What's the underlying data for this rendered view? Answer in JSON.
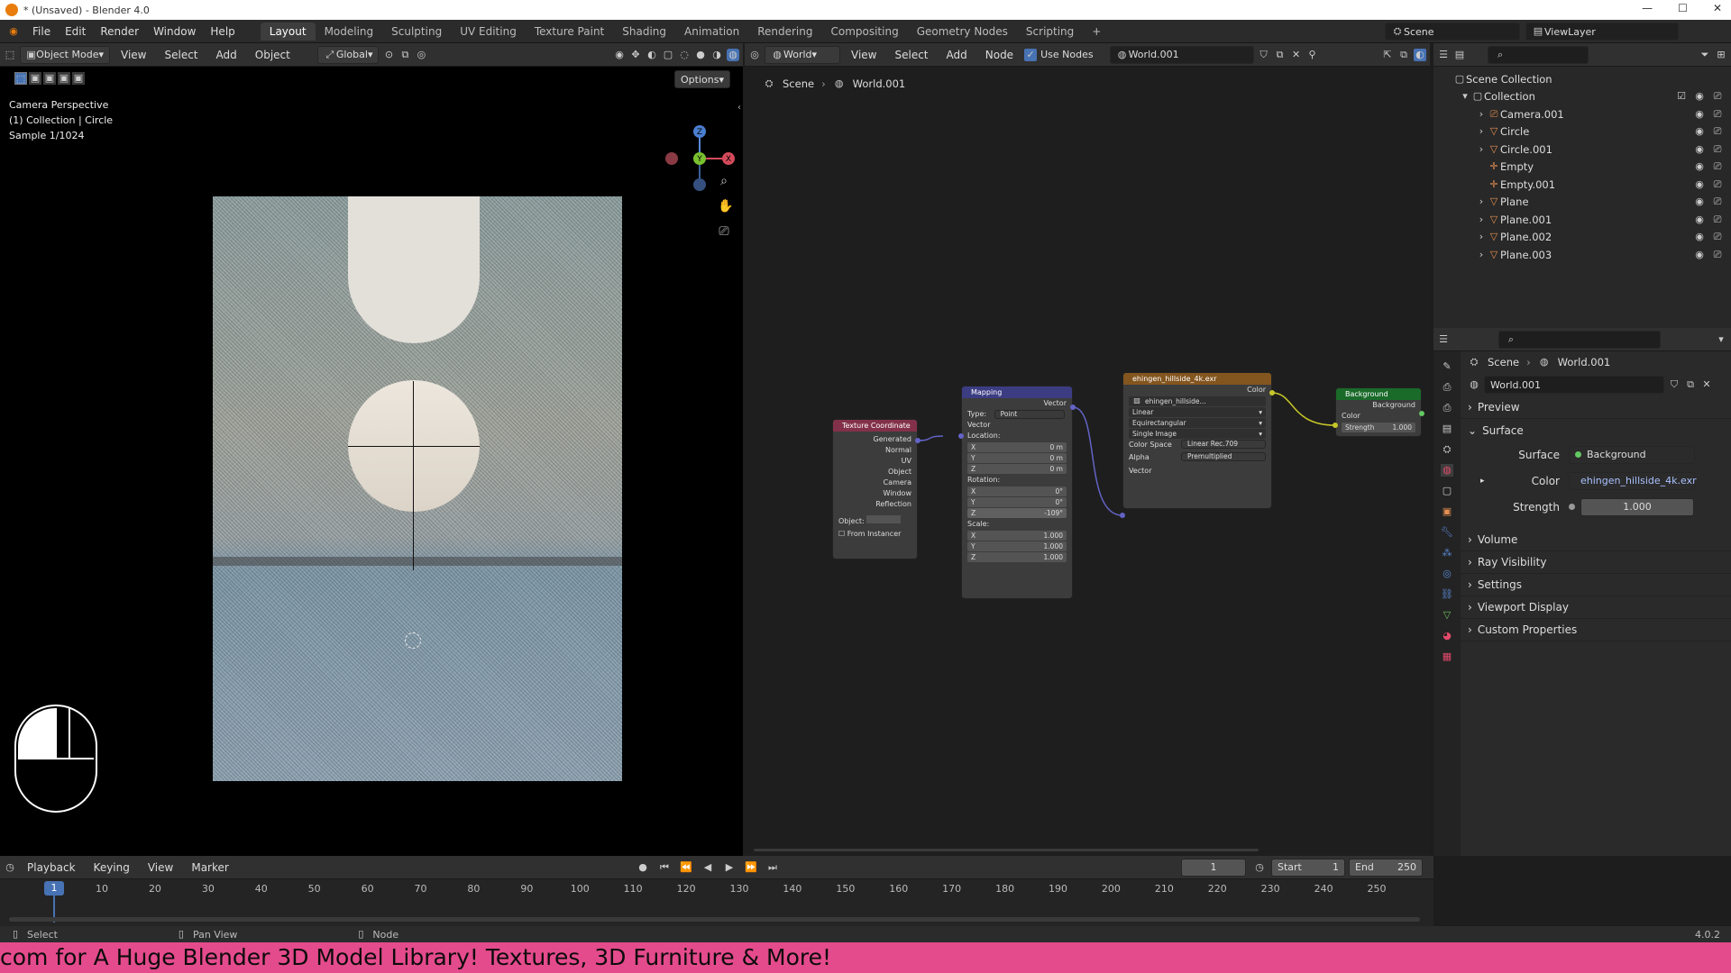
{
  "window": {
    "title": "* (Unsaved) - Blender 4.0",
    "controls": [
      "—",
      "☐",
      "✕"
    ]
  },
  "menu": [
    "File",
    "Edit",
    "Render",
    "Window",
    "Help"
  ],
  "workspaces": [
    "Layout",
    "Modeling",
    "Sculpting",
    "UV Editing",
    "Texture Paint",
    "Shading",
    "Animation",
    "Rendering",
    "Compositing",
    "Geometry Nodes",
    "Scripting",
    "+"
  ],
  "scene_selector": {
    "scene": "Scene",
    "view_layer": "ViewLayer"
  },
  "viewport": {
    "mode": "Object Mode",
    "menus": [
      "View",
      "Select",
      "Add",
      "Object"
    ],
    "transform": "Global",
    "options": "Options",
    "overlay_lines": [
      "Camera Perspective",
      "(1) Collection | Circle",
      "Sample 1/1024"
    ],
    "axes": {
      "z": "Z",
      "y": "Y",
      "x": "X"
    }
  },
  "node_editor": {
    "type": "World",
    "menus": [
      "View",
      "Select",
      "Add",
      "Node"
    ],
    "use_nodes_label": "Use Nodes",
    "world_name": "World.001",
    "breadcrumb": [
      "Scene",
      "World.001"
    ],
    "nodes": {
      "texcoord": {
        "title": "Texture Coordinate",
        "outputs": [
          "Generated",
          "Normal",
          "UV",
          "Object",
          "Camera",
          "Window",
          "Reflection"
        ],
        "object_label": "Object:",
        "from_instancer": "From Instancer"
      },
      "mapping": {
        "title": "Mapping",
        "out": "Vector",
        "type_label": "Type:",
        "type_value": "Point",
        "vector_in": "Vector",
        "location_label": "Location:",
        "location": [
          [
            "X",
            "0 m"
          ],
          [
            "Y",
            "0 m"
          ],
          [
            "Z",
            "0 m"
          ]
        ],
        "rotation_label": "Rotation:",
        "rotation": [
          [
            "X",
            "0°"
          ],
          [
            "Y",
            "0°"
          ],
          [
            "Z",
            "-109°"
          ]
        ],
        "scale_label": "Scale:",
        "scale": [
          [
            "X",
            "1.000"
          ],
          [
            "Y",
            "1.000"
          ],
          [
            "Z",
            "1.000"
          ]
        ]
      },
      "envtex": {
        "title": "ehingen_hillside_4k.exr",
        "out": "Color",
        "image": "ehingen_hillside...",
        "interp": "Linear",
        "projection": "Equirectangular",
        "source": "Single Image",
        "colorspace_label": "Color Space",
        "colorspace": "Linear Rec.709",
        "alpha_label": "Alpha",
        "alpha": "Premultiplied",
        "vector_in": "Vector"
      },
      "background": {
        "title": "Background",
        "out": "Background",
        "color_in": "Color",
        "strength_label": "Strength",
        "strength": "1.000"
      }
    }
  },
  "outliner": {
    "root": "Scene Collection",
    "collection": "Collection",
    "items": [
      "Camera.001",
      "Circle",
      "Circle.001",
      "Empty",
      "Empty.001",
      "Plane",
      "Plane.001",
      "Plane.002",
      "Plane.003"
    ]
  },
  "properties": {
    "breadcrumb": [
      "Scene",
      "World.001"
    ],
    "world_name": "World.001",
    "panels": {
      "preview": "Preview",
      "surface": "Surface"
    },
    "surface_label": "Surface",
    "surface_value": "Background",
    "color_label": "Color",
    "color_value": "ehingen_hillside_4k.exr",
    "strength_label": "Strength",
    "strength_value": "1.000",
    "collapsed": [
      "Volume",
      "Ray Visibility",
      "Settings",
      "Viewport Display",
      "Custom Properties"
    ]
  },
  "timeline": {
    "menus": [
      "Playback",
      "Keying",
      "View",
      "Marker"
    ],
    "current_frame": "1",
    "start_label": "Start",
    "start": "1",
    "end_label": "End",
    "end": "250",
    "ticks": [
      "1",
      "10",
      "20",
      "30",
      "40",
      "50",
      "60",
      "70",
      "80",
      "90",
      "100",
      "110",
      "120",
      "130",
      "140",
      "150",
      "160",
      "170",
      "180",
      "190",
      "200",
      "210",
      "220",
      "230",
      "240",
      "250"
    ]
  },
  "statusbar": {
    "select": "Select",
    "pan": "Pan View",
    "node": "Node",
    "version": "4.0.2"
  },
  "banner": "com for A Huge Blender 3D Model Library! Textures, 3D Furniture & More!",
  "colors": {
    "accent": "#4772b3",
    "texcoord_header": "#83314a",
    "mapping_header": "#3c3c83",
    "envtex_header": "#83551f",
    "background_header": "#1a6a2a",
    "banner": "#e44b8c"
  }
}
